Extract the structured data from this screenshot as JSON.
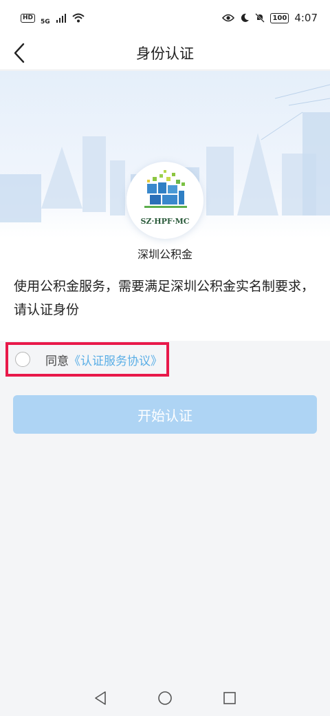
{
  "status_bar": {
    "hd_badge": "HD",
    "network": "5G",
    "battery": "100",
    "time": "4:07"
  },
  "header": {
    "title": "身份认证"
  },
  "org": {
    "logo_text": "SZ·HPF·MC",
    "name": "深圳公积金"
  },
  "main": {
    "description": "使用公积金服务，需要满足深圳公积金实名制要求，请认证身份"
  },
  "agreement": {
    "label": "同意",
    "link_text": "《认证服务协议》",
    "checked": false
  },
  "start_button": {
    "label": "开始认证"
  },
  "colors": {
    "accent": "#5aaee6",
    "button_disabled": "#aed4f4",
    "highlight": "#e8194a"
  }
}
